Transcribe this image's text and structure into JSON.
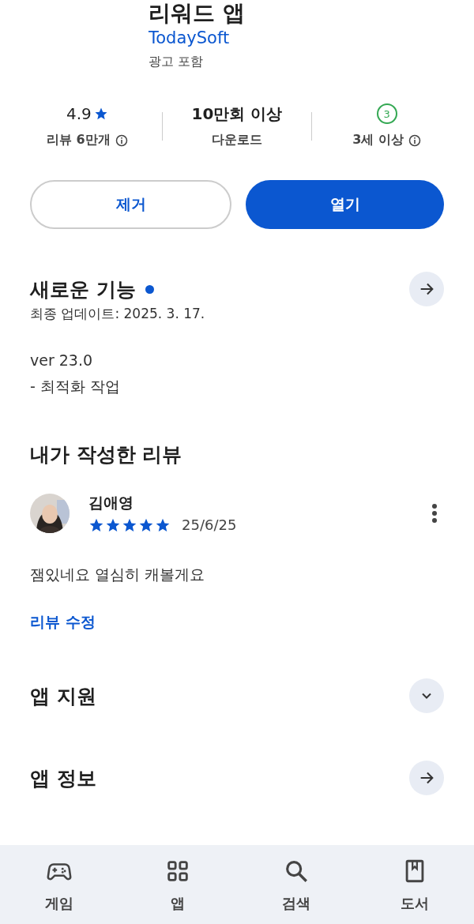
{
  "app": {
    "title": "리워드 앱",
    "developer": "TodaySoft",
    "ads_note": "광고 포함"
  },
  "stats": [
    {
      "kind": "rating",
      "value": "4.9",
      "label": "리뷰 6만개"
    },
    {
      "kind": "plain",
      "value": "10만회 이상",
      "label": "다운로드"
    },
    {
      "kind": "age",
      "value": "3",
      "label": "3세 이상"
    }
  ],
  "buttons": [
    {
      "label": "제거",
      "kind": "outline"
    },
    {
      "label": "열기",
      "kind": "filled"
    }
  ],
  "whats_new": {
    "title": "새로운 기능",
    "updated": "최종 업데이트: 2025. 3. 17.",
    "lines": [
      "ver 23.0",
      "- 최적화 작업"
    ]
  },
  "my_review": {
    "title": "내가 작성한 리뷰",
    "author": "김애영",
    "stars": 5,
    "date": "25/6/25",
    "text": "잼있네요 열심히 캐볼게요",
    "edit_link": "리뷰 수정"
  },
  "sections": [
    {
      "title": "앱 지원",
      "kind": "expand"
    },
    {
      "title": "앱 정보",
      "kind": "arrow"
    }
  ],
  "nav": [
    {
      "label": "게임",
      "kind": "game"
    },
    {
      "label": "앱",
      "kind": "apps"
    },
    {
      "label": "검색",
      "kind": "search"
    },
    {
      "label": "도서",
      "kind": "book"
    }
  ]
}
